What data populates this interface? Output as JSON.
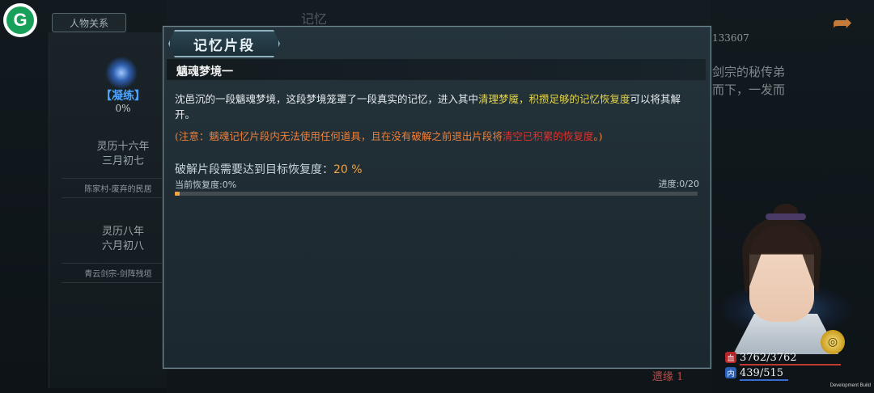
{
  "top": {
    "relations_tab": "人物关系",
    "top_deco": "记忆"
  },
  "left": {
    "cultivation_label": "【凝练】",
    "cultivation_pct": "0%",
    "entry1_date_line1": "灵历十六年",
    "entry1_date_line2": "三月初七",
    "entry1_place": "陈家村-废弃的民居",
    "entry2_date_line1": "灵历八年",
    "entry2_date_line2": "六月初八",
    "entry2_place": "青云剑宗-剑阵残垣"
  },
  "right": {
    "id_text": "133607",
    "story_line1": "剑宗的秘传弟",
    "story_line2": "而下，一发而"
  },
  "dialog": {
    "title": "记忆片段",
    "subtitle": "魑魂梦境一",
    "desc_part1": "沈邑沉的一段魑魂梦境，这段梦境笼罩了一段真实的记忆，进入其中",
    "desc_highlight": "清理梦魇，积攒足够的记忆恢复度",
    "desc_part2": "可以将其解开。",
    "note_part1": "(注意：魑魂记忆片段内无法使用任何道具，且在没有破解之前退出片段将",
    "note_highlight": "清空已积累的恢复度",
    "note_part2": "。)",
    "requirement_label": "破解片段需要达到目标恢复度：",
    "requirement_value": "20 %",
    "current_recovery": "当前恢复度:0%",
    "progress_text": "进度:0/20",
    "progress_fraction": 0.01
  },
  "hero": {
    "hp": "3762/3762",
    "mp": "439/515",
    "hp_icon": "血",
    "mp_icon": "内"
  },
  "bottom_red": "遗缘 1",
  "dev_build": "Development Build",
  "colors": {
    "accent_orange": "#f0a347",
    "highlight_yellow": "#e5d64a",
    "warning_red": "#e0302b",
    "note_orange": "#f07f38"
  }
}
